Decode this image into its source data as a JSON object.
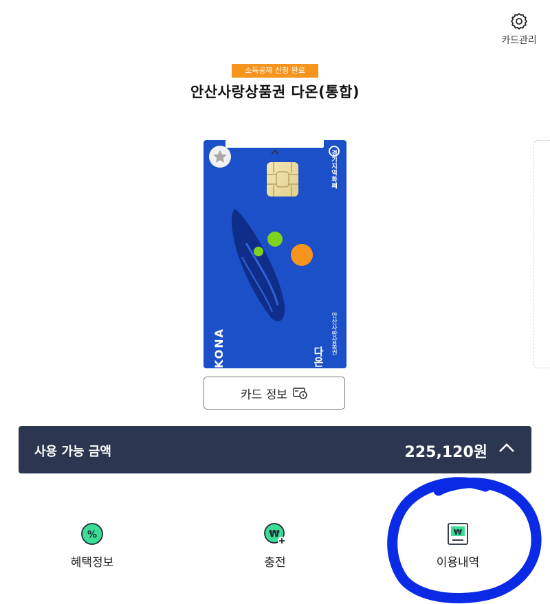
{
  "header": {
    "manage_label": "카드관리",
    "badge": "소득공제 신청 완료",
    "title": "안산사랑상품권  다온(통합)"
  },
  "card": {
    "brand_text": "경기지역화폐",
    "kona_text": "KONA",
    "issuer_text": "안산사랑상품권",
    "dawon_text": "다온",
    "colors": {
      "base": "#1b50c8",
      "dark": "#0f2e8a",
      "green": "#7ed321",
      "orange": "#f7941d"
    }
  },
  "card_info_button": {
    "label": "카드 정보"
  },
  "balance": {
    "label": "사용 가능 금액",
    "amount": "225,120원"
  },
  "menu": [
    {
      "label": "혜택정보",
      "icon": "percent-icon"
    },
    {
      "label": "충전",
      "icon": "won-plus-icon"
    },
    {
      "label": "이용내역",
      "icon": "won-receipt-icon"
    }
  ],
  "colors": {
    "accent_green": "#3ddc97",
    "bar": "#2c3650",
    "badge": "#f7941d",
    "annotation": "#0a2ae6"
  }
}
